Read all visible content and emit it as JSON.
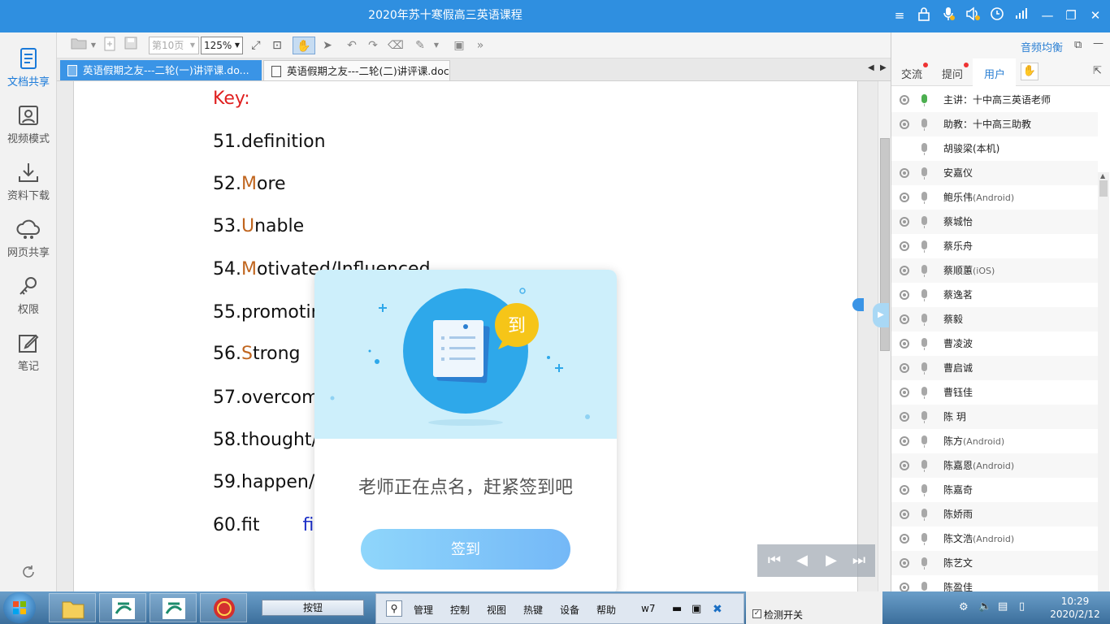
{
  "window": {
    "title": "2020年苏十寒假高三英语课程"
  },
  "leftnav": {
    "items": [
      {
        "label": "文档共享",
        "icon": "document-share-icon",
        "active": true
      },
      {
        "label": "视频模式",
        "icon": "video-mode-icon"
      },
      {
        "label": "资料下载",
        "icon": "download-icon"
      },
      {
        "label": "网页共享",
        "icon": "web-share-icon"
      },
      {
        "label": "权限",
        "icon": "permission-icon"
      },
      {
        "label": "笔记",
        "icon": "notes-icon"
      }
    ]
  },
  "toolbar": {
    "page_label": "第10页",
    "zoom": "125%"
  },
  "doc_tabs": [
    {
      "label": "英语假期之友---二轮(一)讲评课.do...",
      "active": true
    },
    {
      "label": "英语假期之友---二轮(二)讲评课.docx",
      "active": false
    }
  ],
  "document": {
    "key_label": "Key:",
    "lines": [
      {
        "num": "51.",
        "cap": "",
        "rest": "definition",
        "extra": ""
      },
      {
        "num": "52.",
        "cap": "M",
        "rest": "ore",
        "extra": ""
      },
      {
        "num": "53.",
        "cap": "U",
        "rest": "nable",
        "extra": ""
      },
      {
        "num": "54.",
        "cap": "M",
        "rest": "otivated/Influenced",
        "extra": ""
      },
      {
        "num": "55.",
        "cap": "",
        "rest": "promoting",
        "extra": ""
      },
      {
        "num": "56.",
        "cap": "S",
        "rest": "trong",
        "extra": ""
      },
      {
        "num": "57.",
        "cap": "",
        "rest": "overcome",
        "extra": ""
      },
      {
        "num": "58.",
        "cap": "",
        "rest": "thought/p",
        "extra": ""
      },
      {
        "num": "59.",
        "cap": "",
        "rest": "happen/oc",
        "extra": ""
      },
      {
        "num": "60.",
        "cap": "",
        "rest": "fit",
        "extra": "fit i"
      }
    ]
  },
  "right_panel": {
    "audio_balance": "音频均衡",
    "tabs": [
      {
        "label": "交流",
        "dot": true
      },
      {
        "label": "提问",
        "dot": true
      },
      {
        "label": "用户",
        "active": true
      }
    ],
    "users": [
      {
        "name": "主讲：十中高三英语老师",
        "suffix": "",
        "mic_on": true,
        "cam": true
      },
      {
        "name": "助教：十中高三助教",
        "suffix": "",
        "mic_on": false,
        "cam": true
      },
      {
        "name": "胡骏梁(本机)",
        "suffix": "",
        "mic_on": false,
        "cam": false
      },
      {
        "name": "安嘉仪",
        "suffix": "",
        "mic_on": false,
        "cam": true
      },
      {
        "name": "鲍乐伟",
        "suffix": "(Android)",
        "mic_on": false,
        "cam": true
      },
      {
        "name": "蔡城怡",
        "suffix": "",
        "mic_on": false,
        "cam": true
      },
      {
        "name": "蔡乐舟",
        "suffix": "",
        "mic_on": false,
        "cam": true
      },
      {
        "name": "蔡顺蕙",
        "suffix": "(iOS)",
        "mic_on": false,
        "cam": true
      },
      {
        "name": "蔡逸茗",
        "suffix": "",
        "mic_on": false,
        "cam": true
      },
      {
        "name": "蔡毅",
        "suffix": "",
        "mic_on": false,
        "cam": true
      },
      {
        "name": "曹凌波",
        "suffix": "",
        "mic_on": false,
        "cam": true
      },
      {
        "name": "曹启诚",
        "suffix": "",
        "mic_on": false,
        "cam": true
      },
      {
        "name": "曹钰佳",
        "suffix": "",
        "mic_on": false,
        "cam": true
      },
      {
        "name": "陈 玥",
        "suffix": "",
        "mic_on": false,
        "cam": true
      },
      {
        "name": "陈方",
        "suffix": "(Android)",
        "mic_on": false,
        "cam": true
      },
      {
        "name": "陈嘉恩",
        "suffix": "(Android)",
        "mic_on": false,
        "cam": true
      },
      {
        "name": "陈嘉奇",
        "suffix": "",
        "mic_on": false,
        "cam": true
      },
      {
        "name": "陈娇雨",
        "suffix": "",
        "mic_on": false,
        "cam": true
      },
      {
        "name": "陈文浩",
        "suffix": "(Android)",
        "mic_on": false,
        "cam": true
      },
      {
        "name": "陈艺文",
        "suffix": "",
        "mic_on": false,
        "cam": true
      },
      {
        "name": "陈盈佳",
        "suffix": "",
        "mic_on": false,
        "cam": true
      }
    ]
  },
  "popup": {
    "badge": "到",
    "message": "老师正在点名，赶紧签到吧",
    "button": "签到"
  },
  "taskbar": {
    "button_label": "按钮",
    "menu": [
      "管理",
      "控制",
      "视图",
      "热键",
      "设备",
      "帮助",
      "w7"
    ],
    "checkbox_label": "检测开关",
    "time": "10:29",
    "date": "2020/2/12"
  }
}
